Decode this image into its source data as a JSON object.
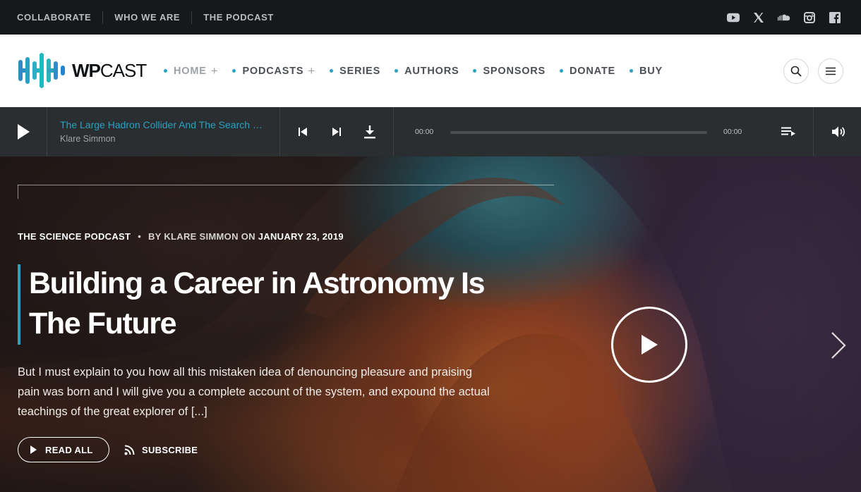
{
  "topbar": {
    "links": [
      "COLLABORATE",
      "WHO WE ARE",
      "THE PODCAST"
    ],
    "social_icons": [
      "youtube-icon",
      "x-icon",
      "soundcloud-icon",
      "instagram-icon",
      "facebook-icon"
    ]
  },
  "header": {
    "logo_bold": "WP",
    "logo_light": "CAST",
    "nav": [
      {
        "label": "HOME",
        "has_submenu": true
      },
      {
        "label": "PODCASTS",
        "has_submenu": true
      },
      {
        "label": "SERIES",
        "has_submenu": false
      },
      {
        "label": "AUTHORS",
        "has_submenu": false
      },
      {
        "label": "SPONSORS",
        "has_submenu": false
      },
      {
        "label": "DONATE",
        "has_submenu": false
      },
      {
        "label": "BUY",
        "has_submenu": false
      }
    ],
    "plus_sign": "+"
  },
  "player": {
    "track_title": "The Large Hadron Collider And The Search For New Physics",
    "track_author": "Klare Simmon",
    "time_current": "00:00",
    "time_total": "00:00",
    "progress": 0
  },
  "hero": {
    "category": "THE SCIENCE PODCAST",
    "bullet": "•",
    "by_label": "BY",
    "author": "KLARE SIMMON",
    "on_label": "ON",
    "date": "JANUARY 23, 2019",
    "title": "Building a Career in Astronomy Is The Future",
    "excerpt": "But I must explain to you how all this mistaken idea of denouncing pleasure and praising pain was born and I will give you a complete account of the system, and expound the actual teachings of the great explorer of [...]",
    "read_all": "READ ALL",
    "subscribe": "SUBSCRIBE"
  },
  "colors": {
    "accent": "#2aa1c0",
    "topbar_bg": "#16191c",
    "player_bg": "#2b2e31"
  }
}
